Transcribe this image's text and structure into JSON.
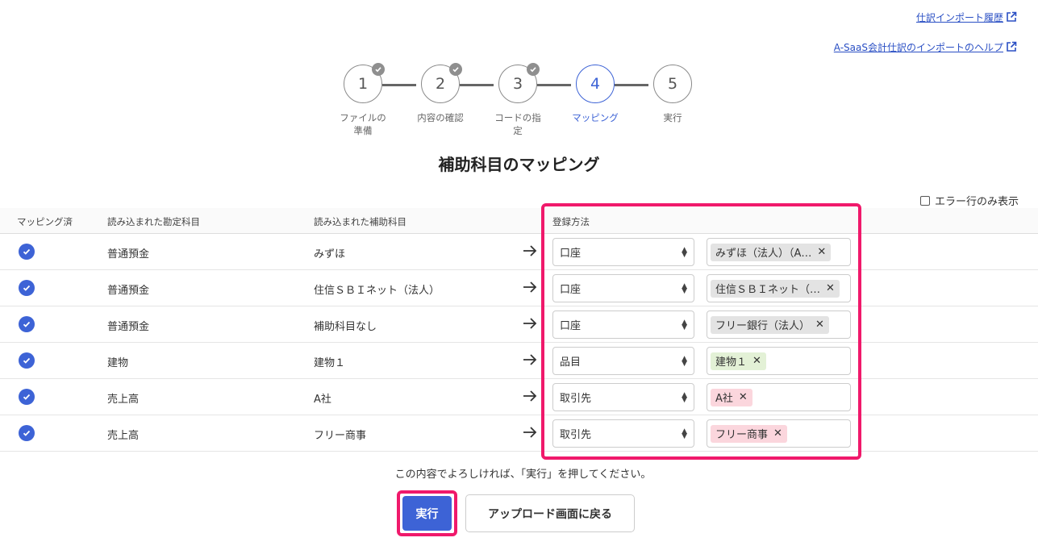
{
  "links": {
    "import_history": "仕訳インポート履歴",
    "import_help": "A-SaaS会計仕訳のインポートのヘルプ"
  },
  "stepper": {
    "steps": [
      {
        "number": "1",
        "label": "ファイルの準備",
        "label_lines": [
          "ファイルの",
          "準備"
        ],
        "state": "done"
      },
      {
        "number": "2",
        "label": "内容の確認",
        "label_lines": [
          "内容の確認"
        ],
        "state": "done"
      },
      {
        "number": "3",
        "label": "コードの指定",
        "label_lines": [
          "コードの指",
          "定"
        ],
        "state": "done"
      },
      {
        "number": "4",
        "label": "マッピング",
        "label_lines": [
          "マッピング"
        ],
        "state": "active"
      },
      {
        "number": "5",
        "label": "実行",
        "label_lines": [
          "実行"
        ],
        "state": "pending"
      }
    ]
  },
  "page_title": "補助科目のマッピング",
  "error_filter": {
    "label": "エラー行のみ表示",
    "checked": false
  },
  "table": {
    "headers": {
      "mapped": "マッピング済",
      "account": "読み込まれた勘定科目",
      "sub_account": "読み込まれた補助科目",
      "method": "登録方法"
    },
    "rows": [
      {
        "mapped": true,
        "account": "普通預金",
        "sub_account": "みずほ",
        "method": "口座",
        "value": "みずほ（法人）（A…",
        "chip_color": "gray"
      },
      {
        "mapped": true,
        "account": "普通預金",
        "sub_account": "住信ＳＢＩネット（法人）",
        "method": "口座",
        "value": "住信ＳＢＩネット（…",
        "chip_color": "gray"
      },
      {
        "mapped": true,
        "account": "普通預金",
        "sub_account": "補助科目なし",
        "method": "口座",
        "value": "フリー銀行（法人）",
        "chip_color": "gray"
      },
      {
        "mapped": true,
        "account": "建物",
        "sub_account": "建物１",
        "method": "品目",
        "value": "建物１",
        "chip_color": "green"
      },
      {
        "mapped": true,
        "account": "売上高",
        "sub_account": "A社",
        "method": "取引先",
        "value": "A社",
        "chip_color": "pink"
      },
      {
        "mapped": true,
        "account": "売上高",
        "sub_account": "フリー商事",
        "method": "取引先",
        "value": "フリー商事",
        "chip_color": "pink"
      }
    ]
  },
  "confirm_text": "この内容でよろしければ、「実行」を押してください。",
  "buttons": {
    "execute": "実行",
    "back": "アップロード画面に戻る"
  },
  "colors": {
    "accent": "#3d63d6",
    "highlight": "#f0196b",
    "chip_gray": "#e3e3e3",
    "chip_green": "#e3f1d6",
    "chip_pink": "#fbd6dd"
  },
  "icons": {
    "external_link": "external-link-icon",
    "step_done": "check-icon",
    "mapped": "check-circle-icon",
    "row_arrow": "arrow-right-icon",
    "chip_remove": "close-icon",
    "select_caret": "sort-caret-icon"
  }
}
